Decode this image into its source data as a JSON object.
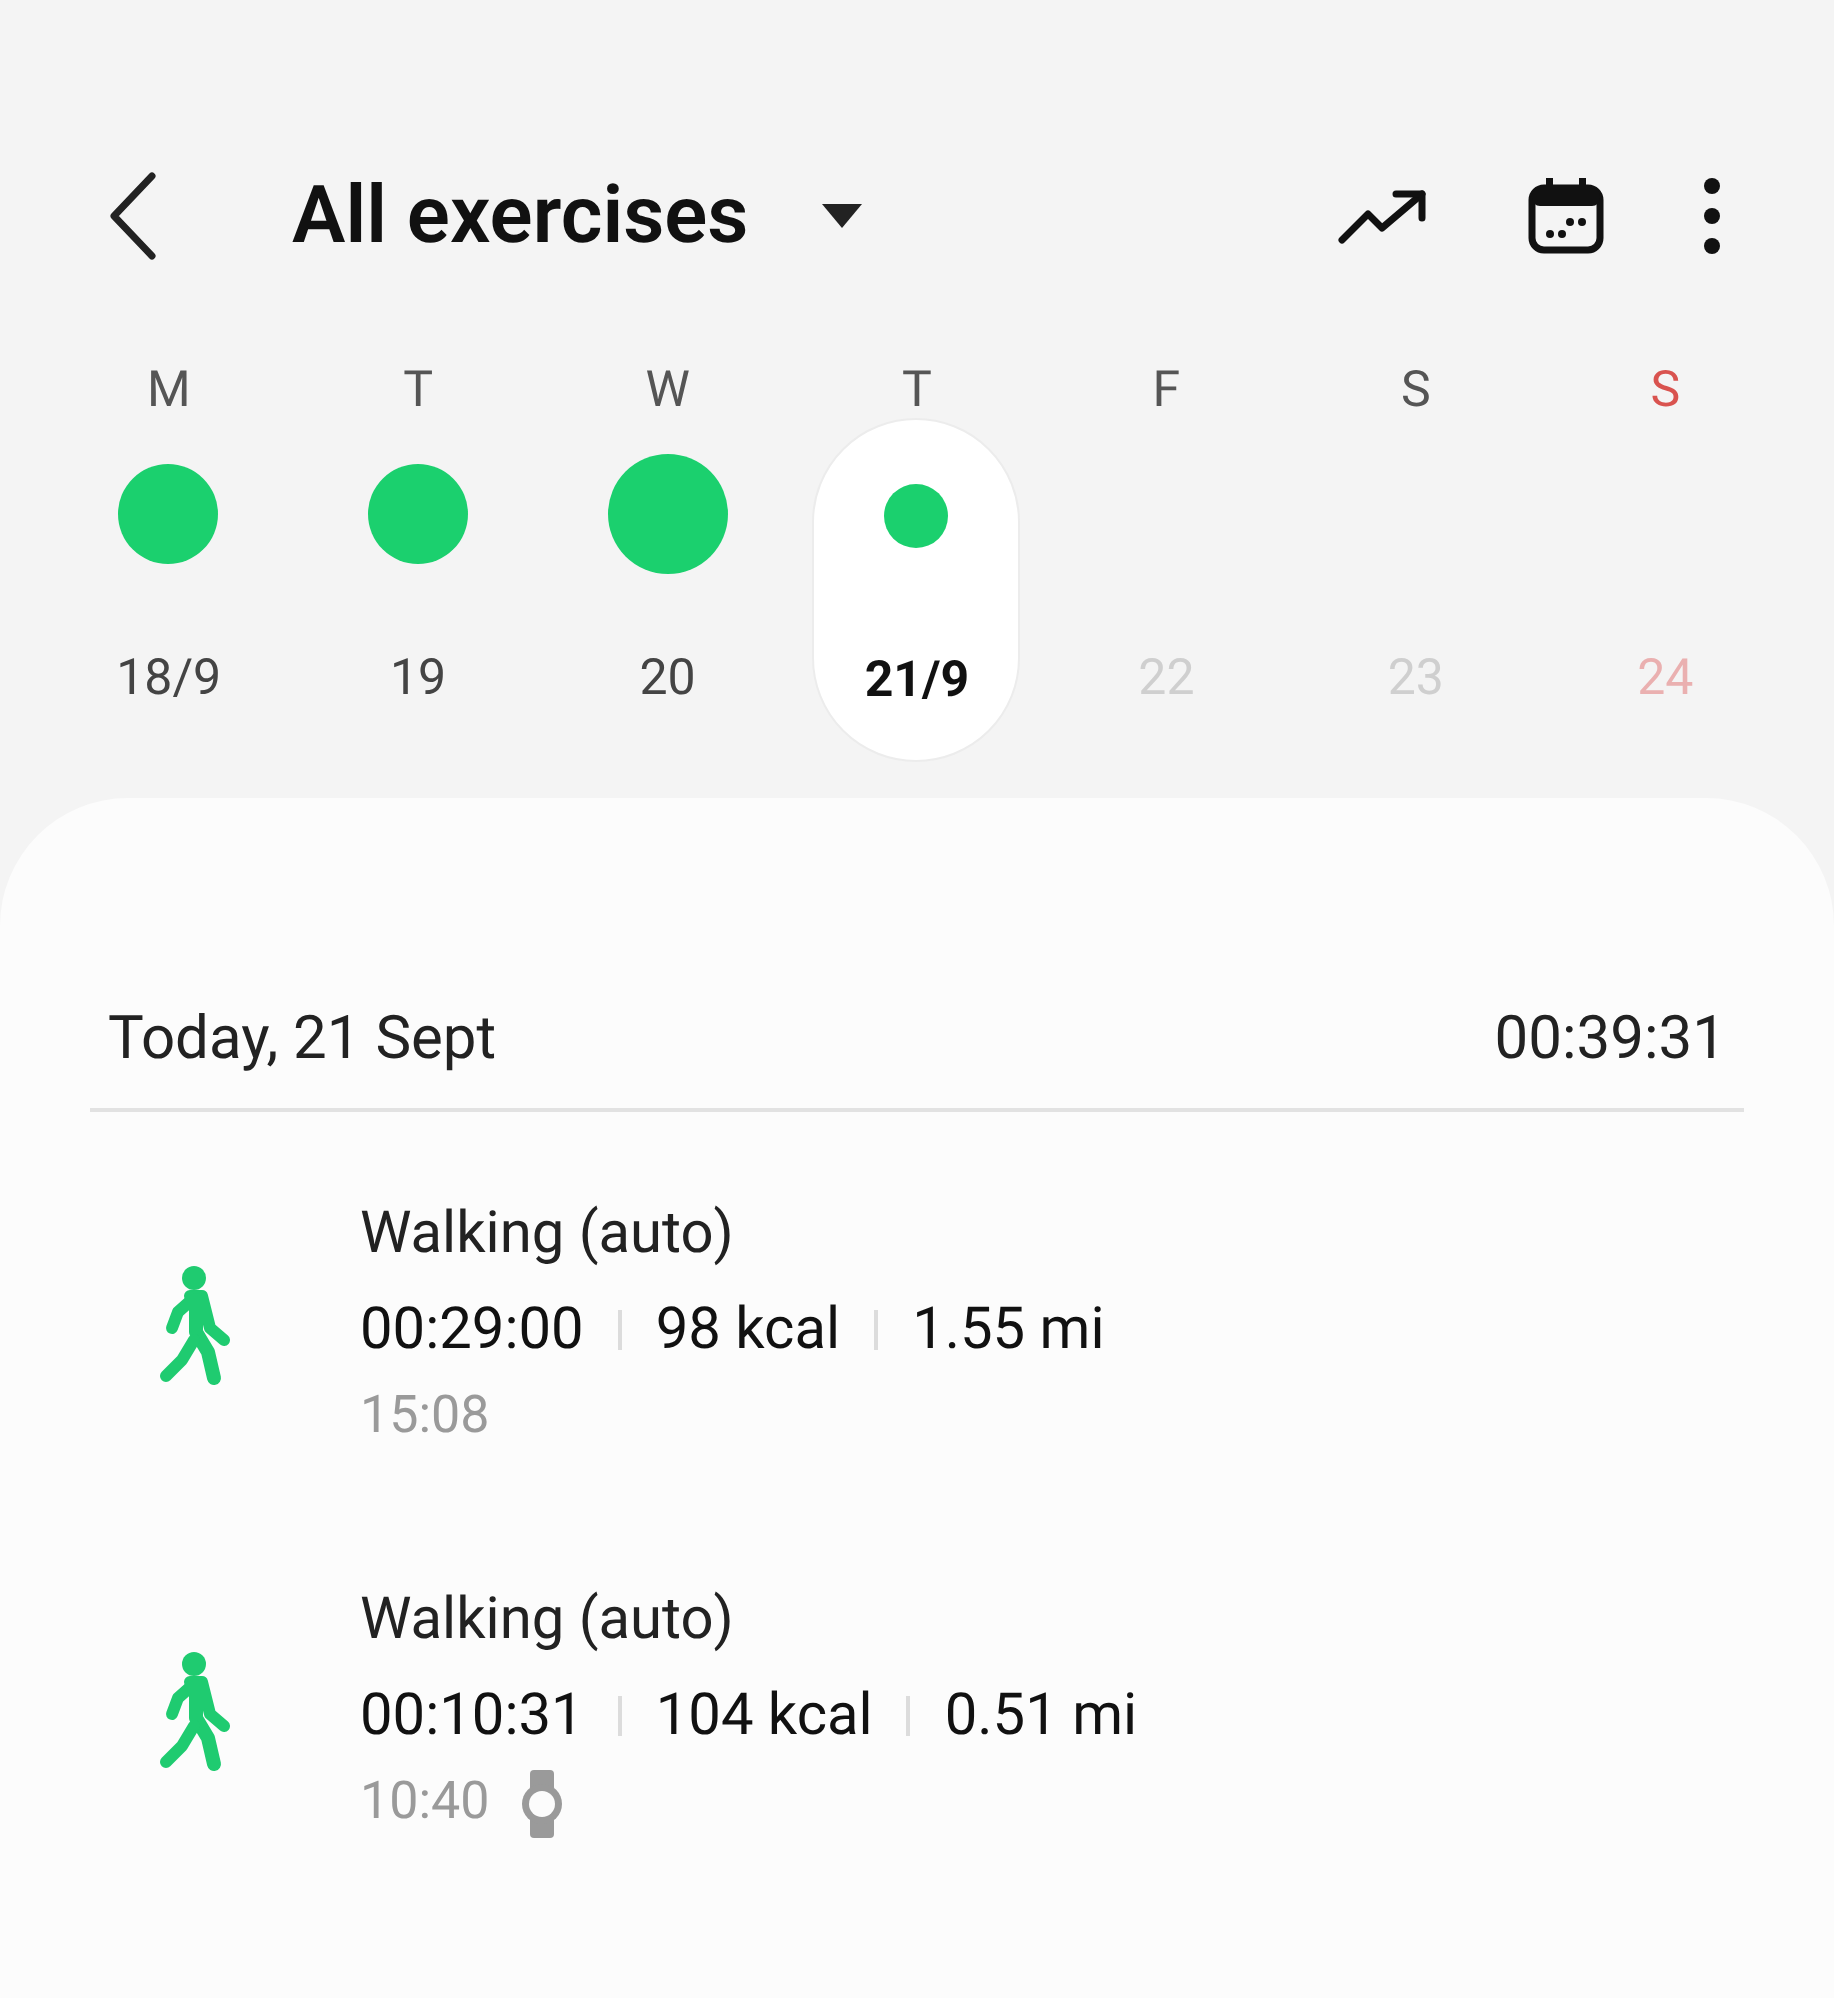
{
  "header": {
    "title": "All exercises"
  },
  "week": [
    {
      "letter": "M",
      "date": "18/9",
      "kind": "dot",
      "selected": false,
      "disabled": false,
      "weekend": false
    },
    {
      "letter": "T",
      "date": "19",
      "kind": "dot",
      "selected": false,
      "disabled": false,
      "weekend": false
    },
    {
      "letter": "W",
      "date": "20",
      "kind": "large_dot",
      "selected": false,
      "disabled": false,
      "weekend": false
    },
    {
      "letter": "T",
      "date": "21/9",
      "kind": "small_dot",
      "selected": true,
      "disabled": false,
      "weekend": false
    },
    {
      "letter": "F",
      "date": "22",
      "kind": "empty",
      "selected": false,
      "disabled": true,
      "weekend": false
    },
    {
      "letter": "S",
      "date": "23",
      "kind": "empty",
      "selected": false,
      "disabled": true,
      "weekend": false
    },
    {
      "letter": "S",
      "date": "24",
      "kind": "empty",
      "selected": false,
      "disabled": true,
      "weekend": true
    }
  ],
  "day": {
    "label": "Today, 21 Sept",
    "total": "00:39:31"
  },
  "entries": [
    {
      "title": "Walking (auto)",
      "stats": [
        "00:29:00",
        "98 kcal",
        "1.55 mi"
      ],
      "time": "15:08",
      "from_watch": false
    },
    {
      "title": "Walking (auto)",
      "stats": [
        "00:10:31",
        "104 kcal",
        "0.51 mi"
      ],
      "time": "10:40",
      "from_watch": true
    }
  ]
}
